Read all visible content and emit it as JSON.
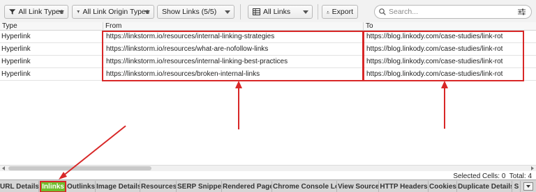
{
  "toolbar": {
    "link_types": "All Link Types",
    "link_origin_types": "All Link Origin Types",
    "show_links": "Show Links (5/5)",
    "all_links": "All Links",
    "export": "Export",
    "search_placeholder": "Search..."
  },
  "table": {
    "columns": [
      "Type",
      "From",
      "To"
    ],
    "rows": [
      {
        "type": "Hyperlink",
        "from": "https://linkstorm.io/resources/internal-linking-strategies",
        "to": "https://blog.linkody.com/case-studies/link-rot"
      },
      {
        "type": "Hyperlink",
        "from": "https://linkstorm.io/resources/what-are-nofollow-links",
        "to": "https://blog.linkody.com/case-studies/link-rot"
      },
      {
        "type": "Hyperlink",
        "from": "https://linkstorm.io/resources/internal-linking-best-practices",
        "to": "https://blog.linkody.com/case-studies/link-rot"
      },
      {
        "type": "Hyperlink",
        "from": "https://linkstorm.io/resources/broken-internal-links",
        "to": "https://blog.linkody.com/case-studies/link-rot"
      }
    ]
  },
  "status": {
    "text": "Selected Cells: 0  Total: 4"
  },
  "tabs": [
    {
      "label": "URL Details"
    },
    {
      "label": "Inlinks"
    },
    {
      "label": "Outlinks"
    },
    {
      "label": "Image Details"
    },
    {
      "label": "Resources"
    },
    {
      "label": "SERP Snippet"
    },
    {
      "label": "Rendered Page"
    },
    {
      "label": "Chrome Console Log"
    },
    {
      "label": "View Source"
    },
    {
      "label": "HTTP Headers"
    },
    {
      "label": "Cookies"
    },
    {
      "label": "Duplicate Details"
    },
    {
      "label": "S"
    }
  ],
  "colors": {
    "annotation": "#d82727",
    "active_tab": "#6fbd2c"
  },
  "icons": [
    "filter-icon",
    "filter-icon",
    "table-icon",
    "export-icon",
    "search-icon",
    "settings-sliders-icon",
    "chevron-down-icon"
  ]
}
